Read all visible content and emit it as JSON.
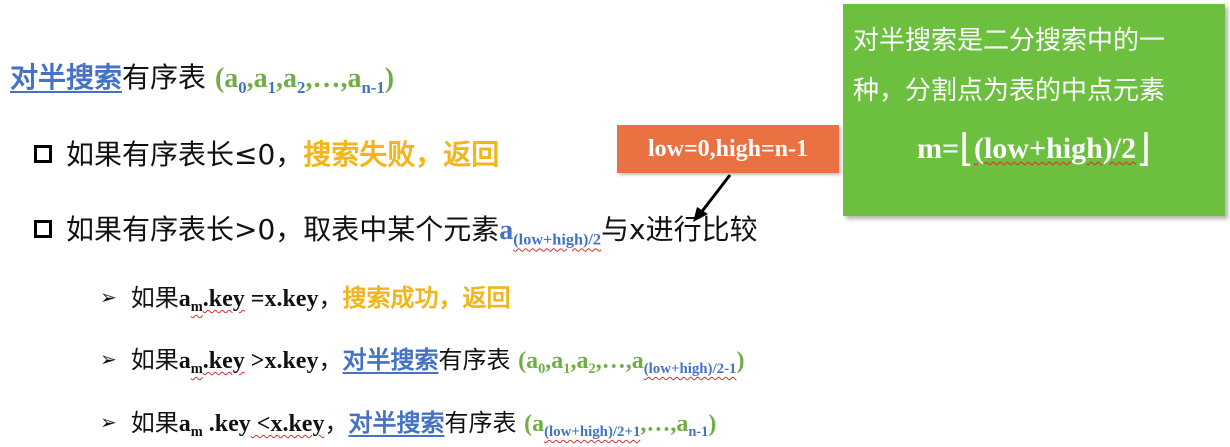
{
  "line1": {
    "term": "对半搜索",
    "rest": "有序表",
    "seq_open": "(a",
    "sub0": "0",
    "a1": ",a",
    "sub1": "1",
    "a2": ",a",
    "sub2": "2",
    "dots": ",…,a",
    "subn": "n-1",
    "seq_close": ")"
  },
  "bullet1": {
    "text": "如果有序表长≤0，",
    "highlight": "搜索失败，返回"
  },
  "bullet2": {
    "text": "如果有序表长>0，取表中某个元素",
    "elem": "a",
    "sub": "(low+high)/2",
    "tail": "与x进行比较"
  },
  "sub1": {
    "prefix": "如果",
    "am": "a",
    "am_sub": "m",
    "key": ".key",
    "op": " =x.key",
    "comma": "，",
    "highlight": "搜索成功，返回"
  },
  "sub2": {
    "prefix": "如果",
    "am": "a",
    "am_sub": "m",
    "key": ".key",
    "op": " >x.key",
    "comma": "，",
    "term": "对半搜索",
    "rest": "有序表",
    "seq_open": "(a",
    "s0": "0",
    "c1": ",a",
    "s1": "1",
    "c2": ",a",
    "s2": "2",
    "c3": ",…,a",
    "sub_mid": "(low+high)/2-1",
    "seq_close": ")"
  },
  "sub3": {
    "prefix": "如果",
    "am": "a",
    "am_sub": "m",
    "key": " .key",
    "op": " <x.key",
    "comma": "，",
    "term": "对半搜索",
    "rest": "有序表",
    "seq_open": "(a",
    "sub_mid": "(low+high)/2+1",
    "c1": ",…,a",
    "subn": "n-1",
    "seq_close": ")"
  },
  "orange_box": {
    "text": "low=0,high=n-1"
  },
  "green_box": {
    "line1": "对半搜索是二分搜索中的一",
    "line2": "种，分割点为表的中点元素",
    "formula_m": "m=",
    "formula_body": "(low+high)/2"
  }
}
